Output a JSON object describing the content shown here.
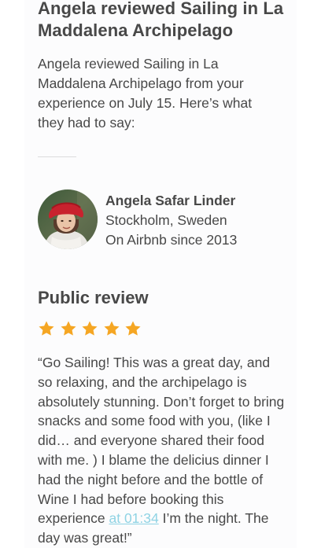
{
  "review": {
    "heading": "Angela reviewed Sailing in La Maddalena Archipelago",
    "intro": "Angela reviewed Sailing in La Maddalena Archipelago from your experience on July 15. Here’s what they had to say:"
  },
  "host": {
    "name": "Angela Safar Linder",
    "location": "Stockholm, Sweden",
    "since": "On Airbnb since 2013",
    "avatar_icon": "profile-photo"
  },
  "public_review": {
    "title": "Public review",
    "rating": 5,
    "rating_max": 5,
    "star_color": "#f5a623",
    "text_before": "“Go Sailing! This was a great day, and so relaxing, and the archipelago is absolutely stunning. Don’t forget to bring snacks and some food with you, (like I did… and everyone shared their food with me. ) I blame the delicius dinner I had the night before and the bottle of Wine I had before booking this experience ",
    "timestamp_link": "at 01:34",
    "text_after": " I’m the night. The day was great!”"
  },
  "colors": {
    "text": "#484848",
    "link": "#8fd3e4",
    "divider": "#dcdcdc"
  }
}
